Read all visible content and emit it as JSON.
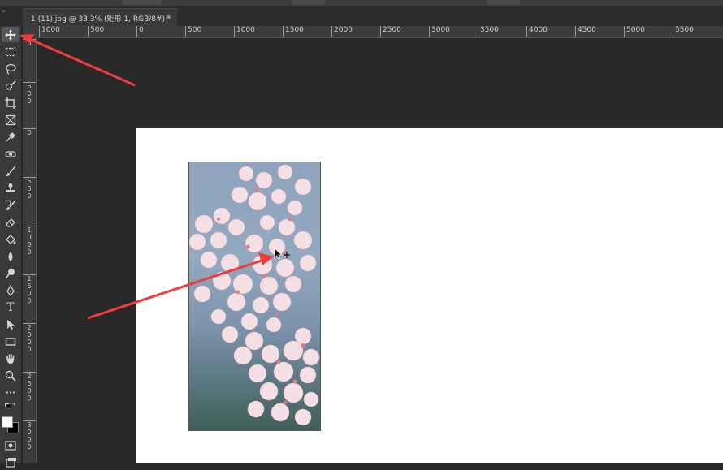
{
  "document_tab": {
    "title": "1 (11).jpg @ 33.3% (矩形 1, RGB/8#) *",
    "close_glyph": "×"
  },
  "ruler": {
    "horizontal_labels": [
      "1000",
      "500",
      "0",
      "500",
      "1000",
      "1500",
      "2000",
      "2500",
      "3000",
      "3500",
      "4000",
      "4500",
      "5000",
      "5500"
    ],
    "vertical_labels": [
      "0",
      "500",
      "0",
      "500",
      "1000",
      "1500",
      "2000",
      "2500",
      "3000"
    ]
  },
  "toolbar": {
    "tools": [
      "move-icon",
      "marquee-icon",
      "lasso-icon",
      "quick-select-icon",
      "crop-icon",
      "frame-icon",
      "eyedropper-icon",
      "healing-icon",
      "brush-icon",
      "stamp-icon",
      "history-brush-icon",
      "eraser-icon",
      "paint-bucket-icon",
      "blur-icon",
      "dodge-icon",
      "pen-icon",
      "type-icon",
      "path-select-icon",
      "rectangle-icon",
      "hand-icon",
      "zoom-icon",
      "more-tools-icon"
    ],
    "type_tool_glyph": "T",
    "more_glyph": "···",
    "active_tool": "move-icon"
  },
  "colors": {
    "foreground": "#ffffff",
    "background": "#000000",
    "annotation_arrow": "#ef3b3b",
    "canvas_bg": "#282828"
  }
}
